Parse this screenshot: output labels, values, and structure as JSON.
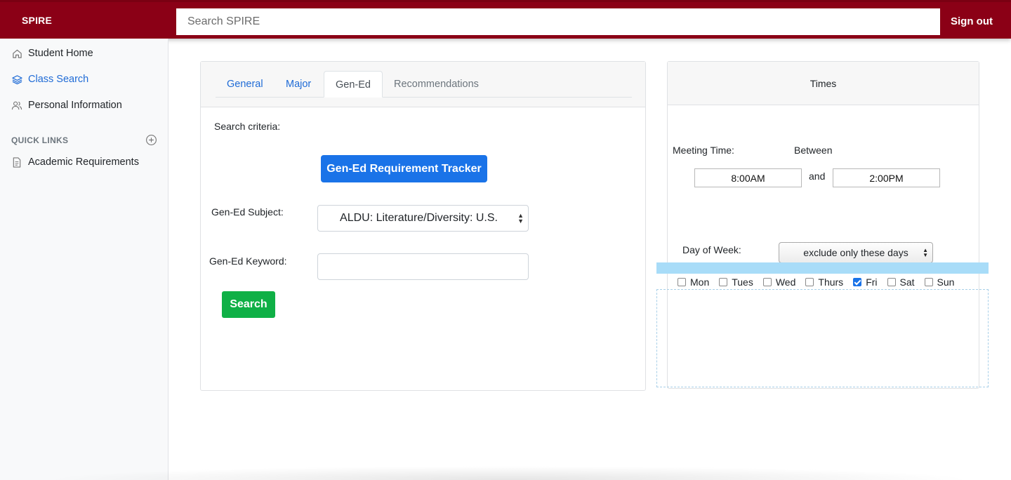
{
  "header": {
    "brand": "SPIRE",
    "search_placeholder": "Search SPIRE",
    "signout_label": "Sign out",
    "color": "#8b0016"
  },
  "sidebar": {
    "items": [
      {
        "label": "Student Home",
        "icon": "home-icon",
        "active": false
      },
      {
        "label": "Class Search",
        "icon": "layers-icon",
        "active": true
      },
      {
        "label": "Personal Information",
        "icon": "users-icon",
        "active": false
      }
    ],
    "quick_links_header": "QUICK LINKS",
    "quick_links": [
      {
        "label": "Academic Requirements",
        "icon": "document-icon"
      }
    ]
  },
  "search_card": {
    "tabs": [
      {
        "label": "General",
        "active": false
      },
      {
        "label": "Major",
        "active": false
      },
      {
        "label": "Gen-Ed",
        "active": true
      },
      {
        "label": "Recommendations",
        "active": false
      }
    ],
    "criteria_label": "Search criteria:",
    "tracker_button": "Gen-Ed Requirement Tracker",
    "subject_label": "Gen-Ed Subject:",
    "subject_value": "ALDU: Literature/Diversity: U.S.",
    "keyword_label": "Gen-Ed Keyword:",
    "keyword_value": "",
    "search_button": "Search"
  },
  "times_card": {
    "title": "Times",
    "meeting_time_label": "Meeting Time:",
    "between_label": "Between",
    "start_time": "8:00AM",
    "and_label": "and",
    "end_time": "2:00PM",
    "day_of_week_label": "Day of Week:",
    "day_mode": "exclude only these days",
    "days": [
      {
        "label": "Mon",
        "checked": false
      },
      {
        "label": "Tues",
        "checked": false
      },
      {
        "label": "Wed",
        "checked": false
      },
      {
        "label": "Thurs",
        "checked": false
      },
      {
        "label": "Fri",
        "checked": true
      },
      {
        "label": "Sat",
        "checked": false
      },
      {
        "label": "Sun",
        "checked": false
      }
    ]
  },
  "colors": {
    "accent_blue": "#1a73e8",
    "search_green": "#0fb046",
    "highlight": "#a8dcf8"
  }
}
